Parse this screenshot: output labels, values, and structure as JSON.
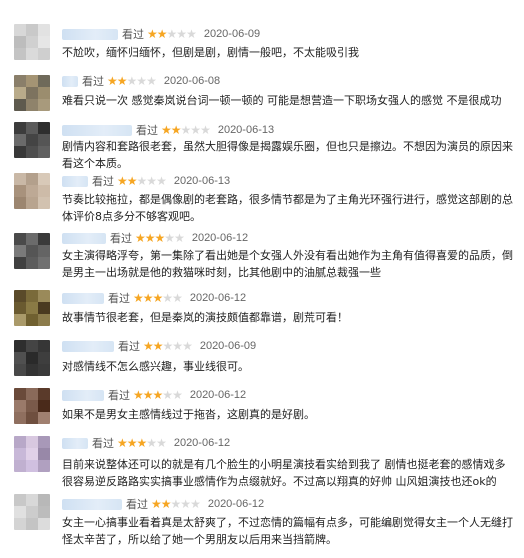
{
  "reviews": [
    {
      "rating_label": "看过",
      "stars": 2,
      "date": "2020-06-09",
      "text": "不尬吹，缅怀归缅怀，但剧是剧，剧情一般吧，不太能吸引我",
      "avatar_colors": [
        "#d8d8d8",
        "#c9c9c9",
        "#e2e2e2",
        "#bdbdbd",
        "#d0d0d0",
        "#e6e6e6",
        "#c4c4c4",
        "#dadada",
        "#cfcfcf"
      ]
    },
    {
      "rating_label": "看过",
      "stars": 2,
      "date": "2020-06-08",
      "text": "难看只说一次 感觉秦岚说台词一顿一顿的 可能是想营造一下职场女强人的感觉 不是很成功",
      "avatar_colors": [
        "#8a7f6a",
        "#a49474",
        "#6f6a5a",
        "#b9ab8a",
        "#7d735f",
        "#9b8d6e",
        "#5e5a4e",
        "#8f836b",
        "#a89a7c"
      ]
    },
    {
      "rating_label": "看过",
      "stars": 2,
      "date": "2020-06-13",
      "text": "剧情内容和套路很老套，虽然大胆得像是揭露娱乐圈，但也只是擦边。不想因为演员的原因来看这个本质。",
      "avatar_colors": [
        "#3c3c3c",
        "#5a5a5a",
        "#2e2e2e",
        "#6a6a6a",
        "#444444",
        "#555555",
        "#383838",
        "#4e4e4e",
        "#606060"
      ]
    },
    {
      "rating_label": "看过",
      "stars": 2,
      "date": "2020-06-13",
      "text": "节奏比较拖拉，都是偶像剧的老套路，很多情节都是为了主角光环强行进行，感觉这部剧的总体评价8点多分不够客观吧。",
      "avatar_colors": [
        "#c9b8a6",
        "#b3a08c",
        "#d8c9b8",
        "#a8927c",
        "#bda995",
        "#cdbba8",
        "#9c8670",
        "#b8a48f",
        "#d2c2b0"
      ]
    },
    {
      "rating_label": "看过",
      "stars": 3,
      "date": "2020-06-12",
      "text": "女主演得略浮夸，第一集除了看出她是个女强人外没有看出她作为主角有值得喜爱的品质，倒是男主一出场就是他的救猫咪时刻，比其他剧中的油腻总裁强一些",
      "avatar_colors": [
        "#4a4a4a",
        "#6b6b6b",
        "#3a3a3a",
        "#7a7a7a",
        "#555555",
        "#646464",
        "#404040",
        "#5c5c5c",
        "#707070"
      ]
    },
    {
      "rating_label": "看过",
      "stars": 3,
      "date": "2020-06-12",
      "text": "故事情节很老套，但是秦岚的演技颇值都靠谱，剧荒可看！",
      "avatar_colors": [
        "#5a4a2a",
        "#7a6a3a",
        "#9a8a5a",
        "#6a5a30",
        "#8a7a45",
        "#4a3a20",
        "#aa9a6a",
        "#706030",
        "#8c7c4c"
      ]
    },
    {
      "rating_label": "看过",
      "stars": 2,
      "date": "2020-06-09",
      "text": "对感情线不怎么感兴趣，事业线很可。",
      "avatar_colors": [
        "#2e2e2e",
        "#444444",
        "#363636",
        "#505050",
        "#2a2a2a",
        "#3e3e3e",
        "#484848",
        "#333333",
        "#3a3a3a"
      ]
    },
    {
      "rating_label": "看过",
      "stars": 3,
      "date": "2020-06-12",
      "text": "如果不是男女主感情线过于拖沓，这剧真的是好剧。",
      "avatar_colors": [
        "#6a4a3a",
        "#8a6a5a",
        "#5a3a2a",
        "#9a7a6a",
        "#7a5a4a",
        "#4a2a1a",
        "#8f6f5f",
        "#6f4f3f",
        "#a08070"
      ]
    },
    {
      "rating_label": "看过",
      "stars": 3,
      "date": "2020-06-12",
      "text": "目前来说整体还可以的就是有几个脸生的小明星演技看实给到我了 剧情也挺老套的感情戏多很容易逆反路路实实搞事业感情作为点缀就好。不过高以翔真的好帅 山风姐演技也还ok的",
      "avatar_colors": [
        "#b8a8c8",
        "#d8c8e0",
        "#a898b8",
        "#c8b8d8",
        "#e0d0e8",
        "#9888a8",
        "#c0b0d0",
        "#d0c0e0",
        "#b0a0c0"
      ]
    },
    {
      "rating_label": "看过",
      "stars": 2,
      "date": "2020-06-12",
      "text": "女主一心搞事业看着真是太舒爽了，不过恋情的篇幅有点多，可能编剧觉得女主一个人无缝打怪太辛苦了，所以给了她一个男朋友以后用来当挡箭牌。",
      "avatar_colors": [
        "#c8c8c8",
        "#d8d8d8",
        "#b8b8b8",
        "#e0e0e0",
        "#cccccc",
        "#bcbcbc",
        "#d4d4d4",
        "#c4c4c4",
        "#dcdcdc"
      ]
    }
  ]
}
